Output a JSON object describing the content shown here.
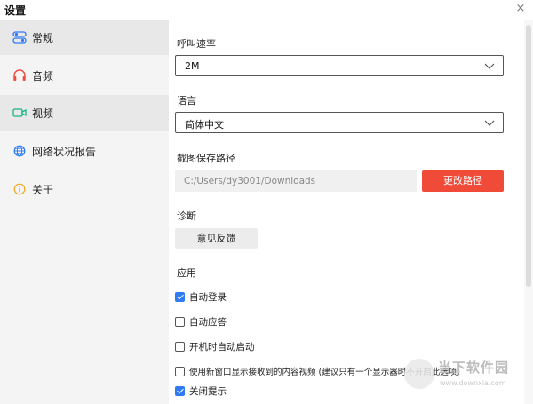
{
  "window": {
    "title": "设置",
    "close_glyph": "×"
  },
  "sidebar": {
    "items": [
      {
        "label": "常规",
        "icon": "toggle-icon",
        "active": true
      },
      {
        "label": "音频",
        "icon": "headphones-icon",
        "active": false
      },
      {
        "label": "视频",
        "icon": "camera-icon",
        "active": false
      },
      {
        "label": "网络状况报告",
        "icon": "globe-icon",
        "active": false
      },
      {
        "label": "关于",
        "icon": "info-icon",
        "active": false
      }
    ]
  },
  "main": {
    "call_rate": {
      "label": "呼叫速率",
      "value": "2M"
    },
    "language": {
      "label": "语言",
      "value": "简体中文"
    },
    "screenshot_path": {
      "label": "截图保存路径",
      "value": "C:/Users/dy3001/Downloads",
      "button": "更改路径"
    },
    "diagnosis": {
      "label": "诊断",
      "button": "意见反馈"
    },
    "app": {
      "label": "应用",
      "options": [
        {
          "label": "自动登录",
          "checked": true
        },
        {
          "label": "自动应答",
          "checked": false
        },
        {
          "label": "开机时自动启动",
          "checked": false
        },
        {
          "label": "使用新窗口显示接收到的内容视频 (建议只有一个显示器时不开启此选项)",
          "checked": false
        },
        {
          "label": "关闭提示",
          "checked": true
        }
      ]
    }
  },
  "watermark": {
    "text": "当下软件园",
    "url": "www.downxia.com"
  },
  "colors": {
    "accent": "#f04b38",
    "check": "#2f7bf5",
    "sidebar_bg": "#f4f4f4"
  }
}
